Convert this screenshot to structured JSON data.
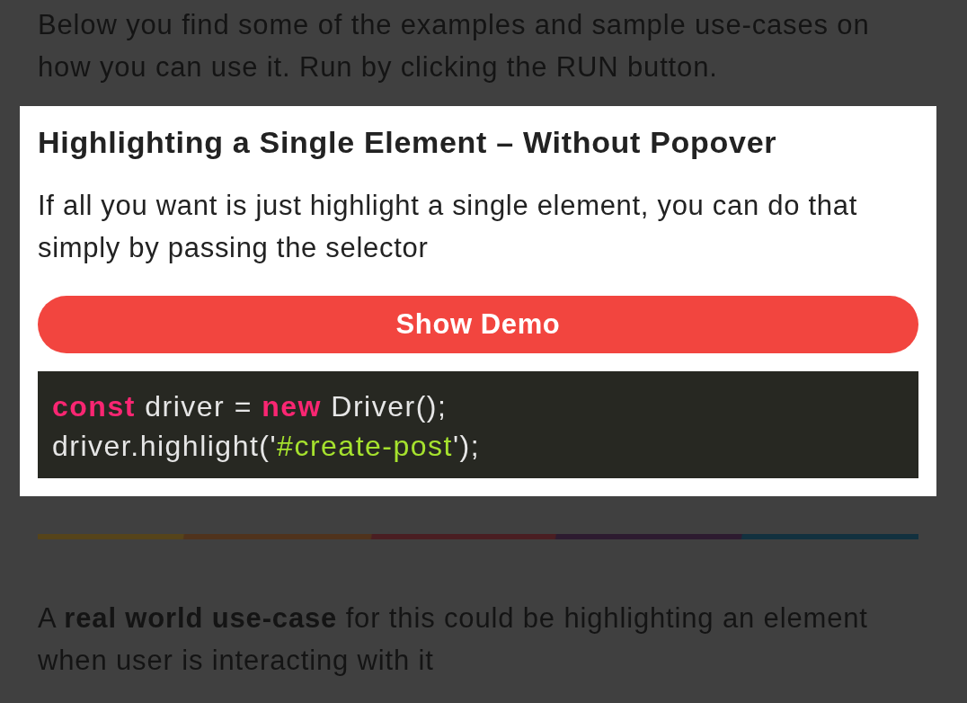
{
  "intro": "Below you find some of the examples and sample use-cases on how you can use it. Run by clicking the RUN button.",
  "example": {
    "title": "Highlighting a Single Element – Without Popover",
    "description": "If all you want is just highlight a single element, you can do that simply by passing the selector",
    "button": "Show Demo",
    "code": [
      [
        {
          "kind": "keyword",
          "text": "const"
        },
        {
          "kind": "plain",
          "text": " driver = "
        },
        {
          "kind": "keyword",
          "text": "new"
        },
        {
          "kind": "plain",
          "text": " Driver();"
        }
      ],
      [
        {
          "kind": "plain",
          "text": "driver.highlight('"
        },
        {
          "kind": "string",
          "text": "#create-post"
        },
        {
          "kind": "plain",
          "text": "');"
        }
      ]
    ]
  },
  "closing": "A **real world use-case** for this could be highlighting an element when user is interacting with it"
}
